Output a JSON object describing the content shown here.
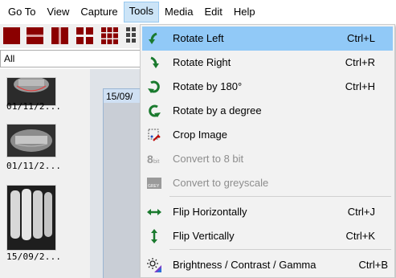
{
  "menubar": {
    "items": [
      {
        "label": "Go To"
      },
      {
        "label": "View"
      },
      {
        "label": "Capture"
      },
      {
        "label": "Tools"
      },
      {
        "label": "Media"
      },
      {
        "label": "Edit"
      },
      {
        "label": "Help"
      }
    ],
    "open_menu": "Tools"
  },
  "toolbar": {
    "buttons": [
      "layout-1x1-icon",
      "layout-2-rows-icon",
      "layout-2-cols-icon",
      "layout-2x2-icon",
      "layout-3x3-icon",
      "layout-more-icon"
    ]
  },
  "filter": {
    "value": "All"
  },
  "thumbnails": [
    {
      "caption": "01/11/2..."
    },
    {
      "caption": "01/11/2..."
    },
    {
      "caption": "15/09/2..."
    }
  ],
  "viewer": {
    "tab_label": "15/09/"
  },
  "tools_menu": {
    "items": [
      {
        "label": "Rotate Left",
        "shortcut": "Ctrl+L",
        "icon": "rotate-left-icon",
        "enabled": true,
        "highlighted": true
      },
      {
        "label": "Rotate Right",
        "shortcut": "Ctrl+R",
        "icon": "rotate-right-icon",
        "enabled": true
      },
      {
        "label": "Rotate by 180°",
        "shortcut": "Ctrl+H",
        "icon": "rotate-180-icon",
        "enabled": true
      },
      {
        "label": "Rotate by a degree",
        "shortcut": "",
        "icon": "rotate-degree-icon",
        "enabled": true
      },
      {
        "label": "Crop Image",
        "shortcut": "",
        "icon": "crop-icon",
        "enabled": true
      },
      {
        "label": "Convert to 8 bit",
        "shortcut": "",
        "icon": "8bit-icon",
        "enabled": false
      },
      {
        "label": "Convert to greyscale",
        "shortcut": "",
        "icon": "greyscale-icon",
        "enabled": false
      },
      {
        "label": "Flip Horizontally",
        "shortcut": "Ctrl+J",
        "icon": "flip-horizontal-icon",
        "enabled": true
      },
      {
        "label": "Flip Vertically",
        "shortcut": "Ctrl+K",
        "icon": "flip-vertical-icon",
        "enabled": true
      },
      {
        "label": "Brightness / Contrast / Gamma",
        "shortcut": "Ctrl+B",
        "icon": "brightness-contrast-icon",
        "enabled": true
      }
    ],
    "icon_text_8bit": "8bit",
    "icon_text_grey": "GREY"
  },
  "colors": {
    "highlight": "#91c9f7",
    "menu_open": "#cce4f7",
    "rotate_green": "#1a7a2e",
    "toolbar_red": "#8b0000"
  }
}
